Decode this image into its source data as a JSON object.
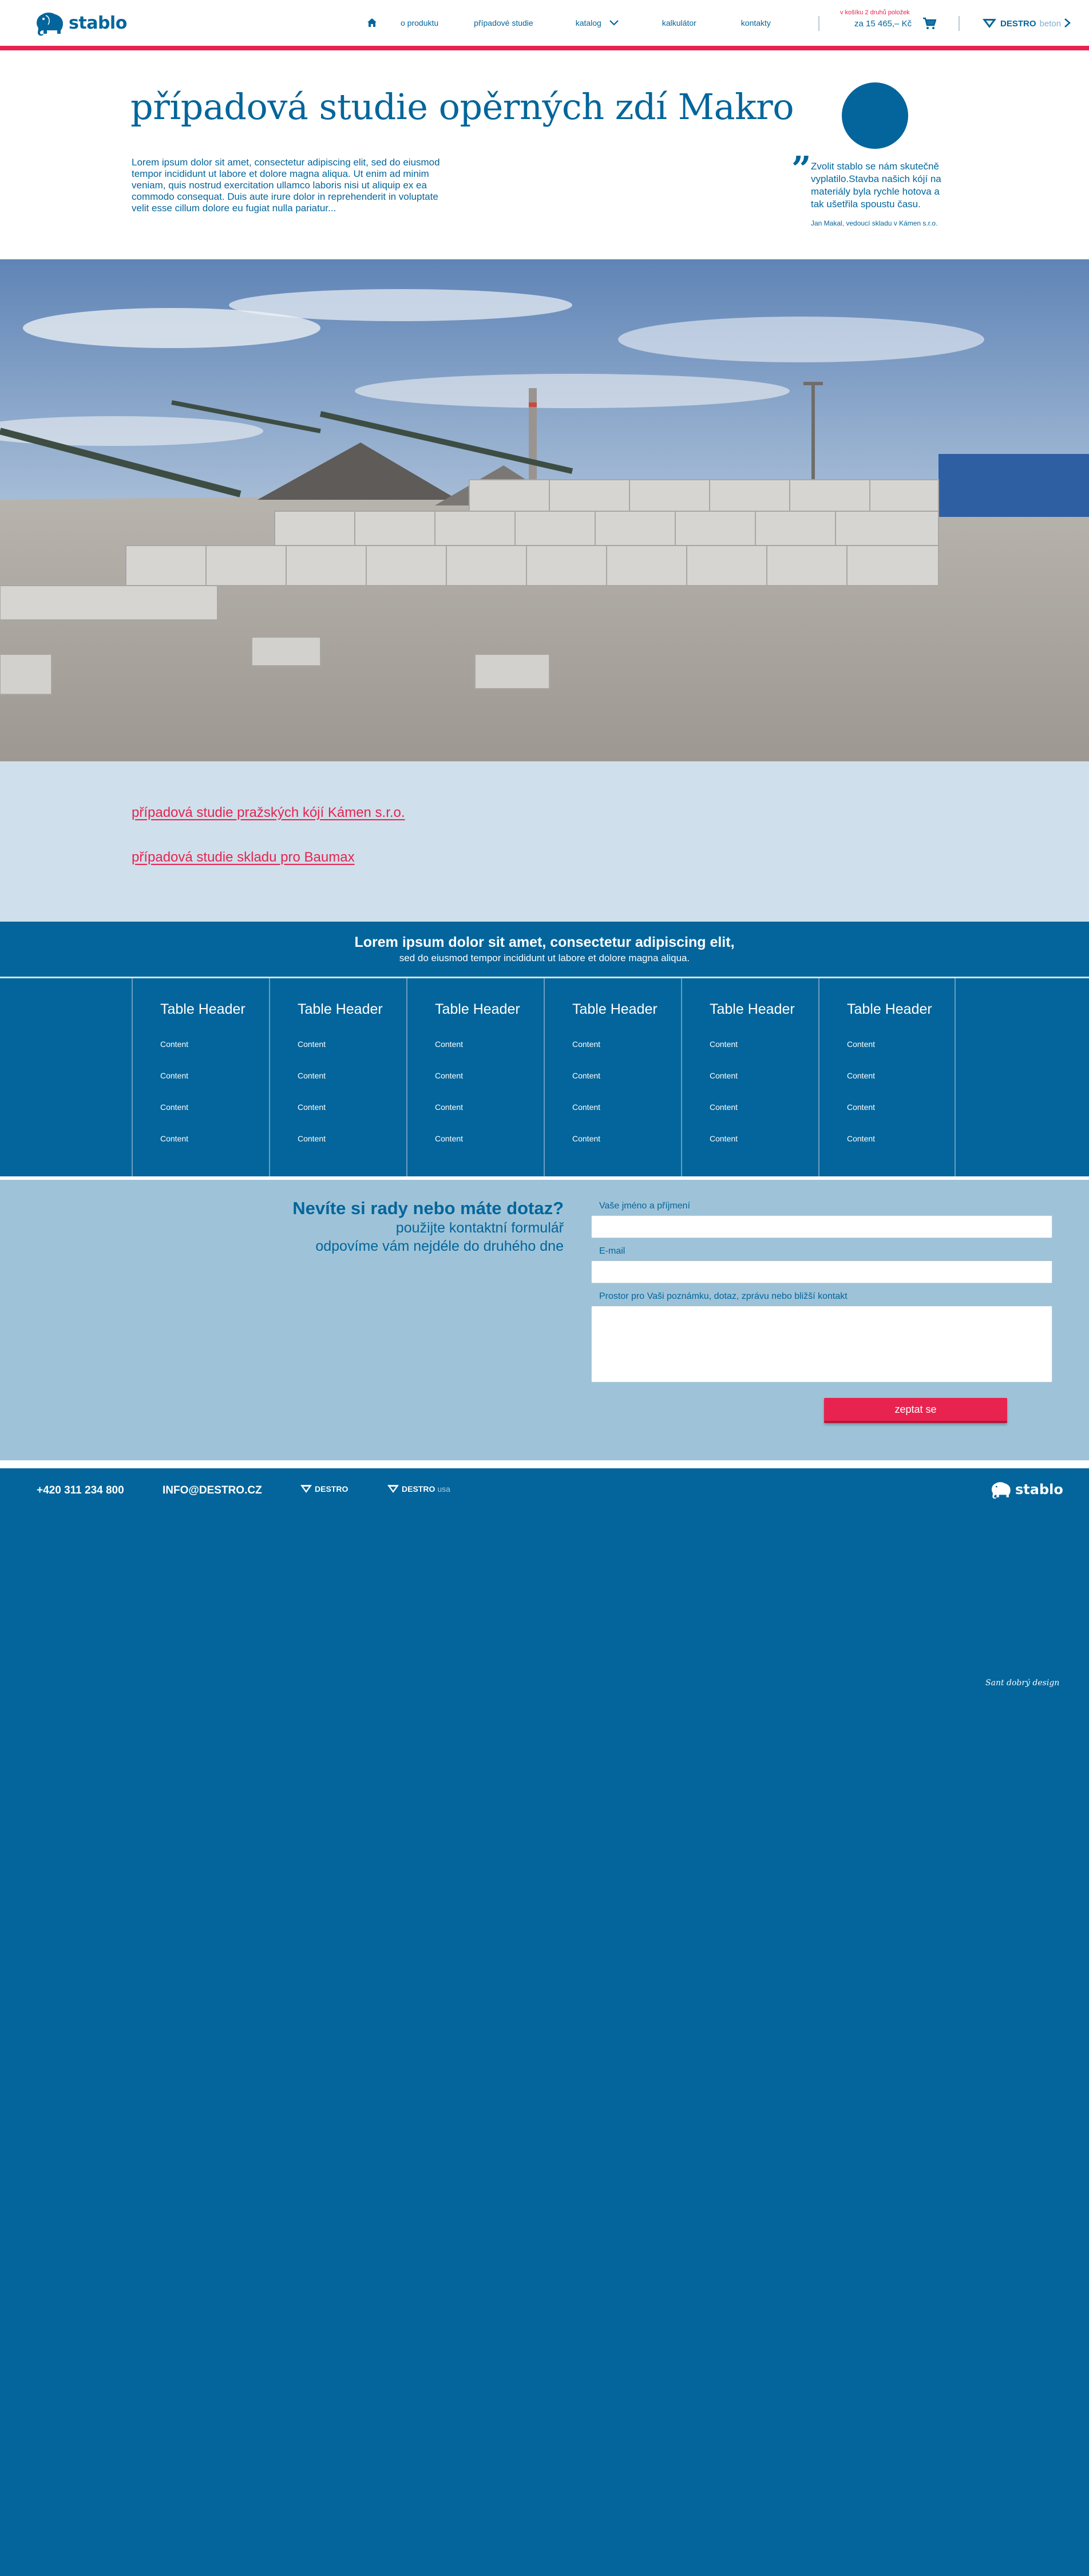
{
  "header": {
    "logo_text": "stablo",
    "nav": {
      "home_icon": "home-icon",
      "o_produktu": "o produktu",
      "pripadove_studie": "případové studie",
      "katalog": "katalog",
      "kalkulator": "kalkulátor",
      "kontakty": "kontakty"
    },
    "cart": {
      "promo": "v košíku 2 druhů položek",
      "price": "za 15 465,– Kč",
      "icon": "cart-icon"
    },
    "destro": {
      "brand": "DESTRO",
      "suffix": "beton"
    }
  },
  "hero": {
    "title": "případová studie opěrných zdí Makro",
    "intro": "Lorem ipsum dolor sit amet, consectetur adipiscing elit, sed do eiusmod tempor incididunt ut labore et dolore magna aliqua. Ut enim ad minim veniam, quis nostrud exercitation ullamco laboris nisi ut aliquip ex ea commodo consequat. Duis aute irure dolor in reprehenderit in voluptate velit esse cillum dolore eu fugiat nulla pariatur...",
    "quote": {
      "mark": "”",
      "text": "Zvolit stablo se nám skutečně vyplatilo.Stavba našich kójí na materiály byla rychle hotova a tak ušetřila spoustu času.",
      "author": "Jan Makal, vedoucí skladu v Kámen s.r.o."
    }
  },
  "case_links": {
    "a": "případová studie pražských kójí Kámen s.r.o.",
    "b": "případová studie skladu pro Baumax"
  },
  "banner": {
    "title": "Lorem ipsum dolor sit amet, consectetur adipiscing elit,",
    "subtitle": "sed do eiusmod tempor incididunt ut labore et dolore magna aliqua."
  },
  "table": {
    "columns": [
      {
        "header": "Table Header",
        "cells": [
          "Content",
          "Content",
          "Content",
          "Content"
        ]
      },
      {
        "header": "Table Header",
        "cells": [
          "Content",
          "Content",
          "Content",
          "Content"
        ]
      },
      {
        "header": "Table Header",
        "cells": [
          "Content",
          "Content",
          "Content",
          "Content"
        ]
      },
      {
        "header": "Table Header",
        "cells": [
          "Content",
          "Content",
          "Content",
          "Content"
        ]
      },
      {
        "header": "Table Header",
        "cells": [
          "Content",
          "Content",
          "Content",
          "Content"
        ]
      },
      {
        "header": "Table Header",
        "cells": [
          "Content",
          "Content",
          "Content",
          "Content"
        ]
      }
    ]
  },
  "contact": {
    "title": "Nevíte si rady nebo máte dotaz?",
    "sub_a": "použijte kontaktní formulář",
    "sub_b": "odpovíme vám nejdéle do druhého dne",
    "name_label": "Vaše jméno a příjmení",
    "name_value": "",
    "email_label": "E-mail",
    "email_value": "",
    "message_label": "Prostor pro Vaši poznámku, dotaz, zprávu nebo bližší kontakt",
    "message_value": "",
    "submit": "zeptat se"
  },
  "footer": {
    "phone": "+420 311 234 800",
    "email": "INFO@DESTRO.CZ",
    "destro1": {
      "brand": "DESTRO",
      "suffix": ""
    },
    "destro2": {
      "brand": "DESTRO",
      "suffix": "usa"
    },
    "logo_text": "stablo",
    "credit": "Sant dobrý design"
  },
  "colors": {
    "primary": "#03659b",
    "accent": "#e8234f",
    "light_blue": "#cfe0ec",
    "form_blue": "#9ec3d8"
  }
}
